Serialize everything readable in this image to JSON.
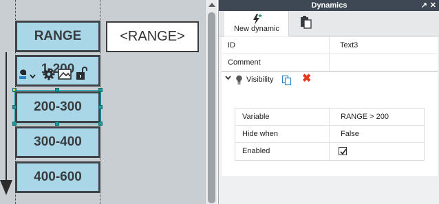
{
  "canvas": {
    "header_label": "RANGE",
    "expression_label": "<RANGE>",
    "ranges": [
      "1-200",
      "200-300",
      "300-400",
      "400-600"
    ],
    "selected_index": 1,
    "mini_toolbar_icons": [
      "bubble-icon",
      "dropdown-chevron-icon",
      "gear-icon",
      "image-icon",
      "lock-open-icon"
    ]
  },
  "panel": {
    "title": "Dynamics",
    "title_icons": [
      "pin-icon",
      "close-icon"
    ],
    "tabs": [
      {
        "label": "New dynamic",
        "icon": "lightning-icon"
      },
      {
        "label": "",
        "icon": "clipboard-icon"
      }
    ],
    "properties": [
      {
        "key": "ID",
        "value": "Text3"
      },
      {
        "key": "Comment",
        "value": ""
      }
    ],
    "visibility": {
      "label": "Visibility",
      "rows": [
        {
          "key": "Variable",
          "value": "RANGE > 200"
        },
        {
          "key": "Hide when",
          "value": "False"
        },
        {
          "key": "Enabled",
          "checked": true
        }
      ]
    }
  },
  "colors": {
    "range_fill": "#a9d7e8",
    "range_border": "#3f4347",
    "selection": "#11a5a5",
    "title_bar": "#3e4854",
    "delete": "#e2391f"
  }
}
